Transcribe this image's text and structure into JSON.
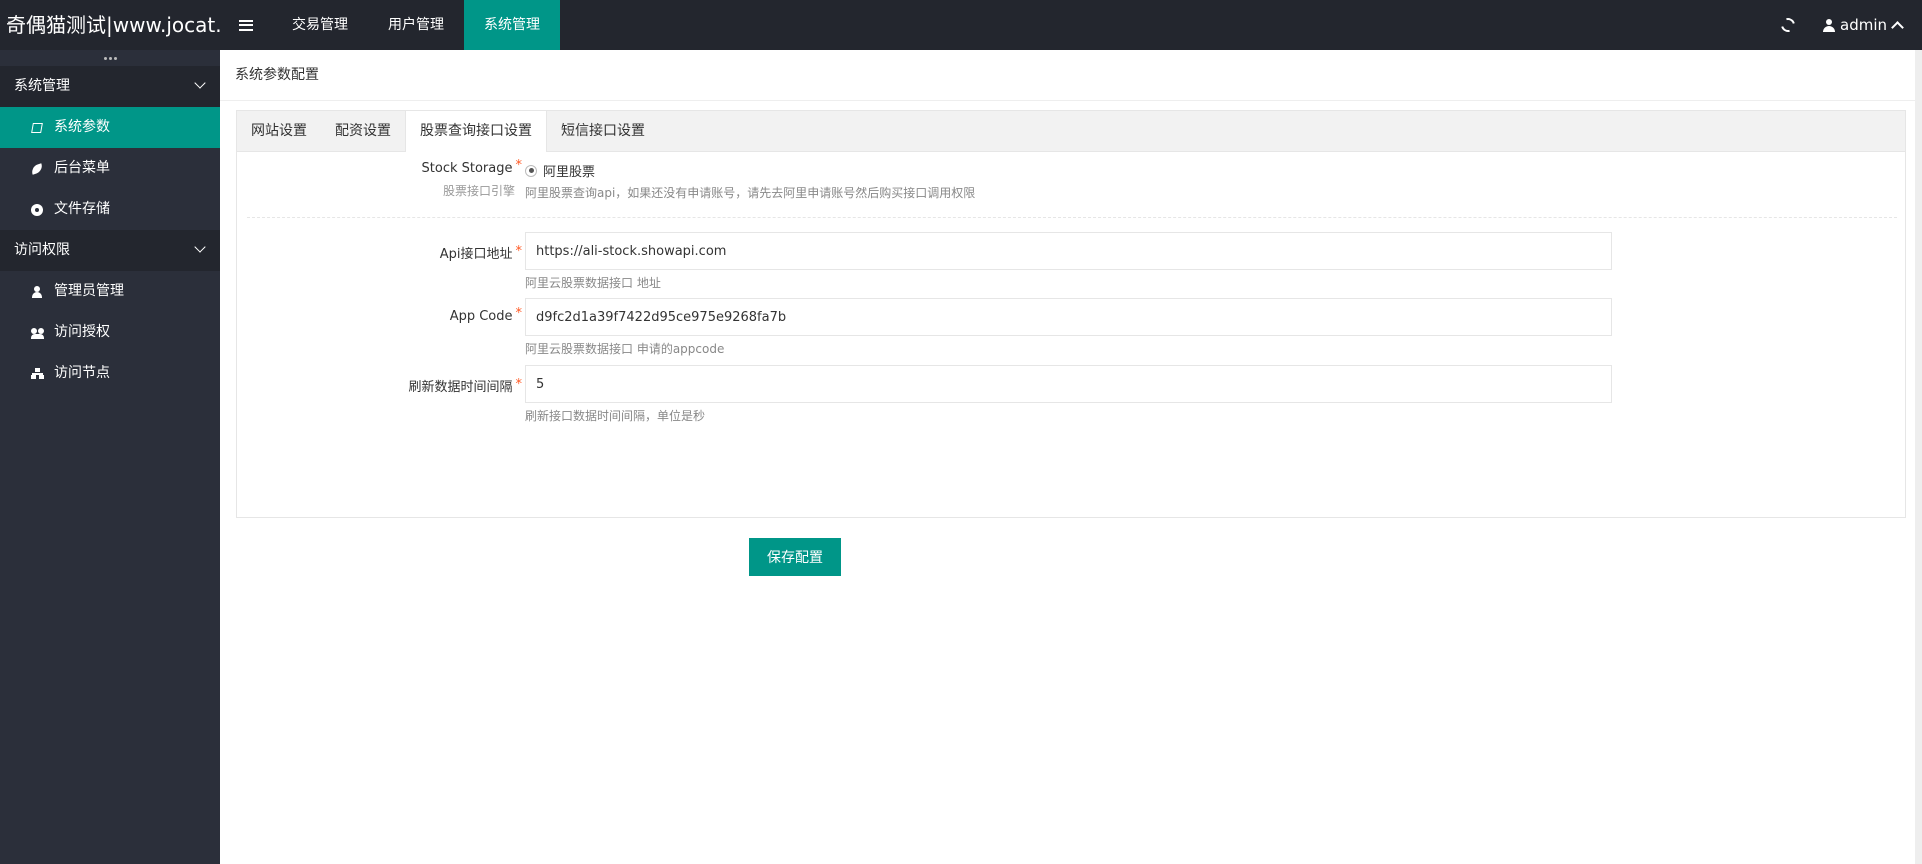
{
  "header": {
    "logo": "奇偶猫测试|www.jocat.cn",
    "nav": [
      {
        "label": "交易管理",
        "active": false
      },
      {
        "label": "用户管理",
        "active": false
      },
      {
        "label": "系统管理",
        "active": true
      }
    ],
    "user": "admin"
  },
  "sidebar": {
    "groups": [
      {
        "title": "系统管理",
        "items": [
          {
            "label": "系统参数",
            "icon": "ban-icon",
            "active": true
          },
          {
            "label": "后台菜单",
            "icon": "leaf-icon",
            "active": false
          },
          {
            "label": "文件存储",
            "icon": "dot-circle-icon",
            "active": false
          }
        ]
      },
      {
        "title": "访问权限",
        "items": [
          {
            "label": "管理员管理",
            "icon": "user-icon",
            "active": false
          },
          {
            "label": "访问授权",
            "icon": "users-icon",
            "active": false
          },
          {
            "label": "访问节点",
            "icon": "sitemap-icon",
            "active": false
          }
        ]
      }
    ]
  },
  "breadcrumb": "系统参数配置",
  "tabs": [
    "网站设置",
    "配资设置",
    "股票查询接口设置",
    "短信接口设置"
  ],
  "active_tab": 2,
  "form": {
    "storage": {
      "label": "Stock Storage",
      "sublabel": "股票接口引擎",
      "option": "阿里股票",
      "help": "阿里股票查询api，如果还没有申请账号，请先去阿里申请账号然后购买接口调用权限"
    },
    "api_url": {
      "label": "Api接口地址",
      "value": "https://ali-stock.showapi.com",
      "help": "阿里云股票数据接口 地址"
    },
    "app_code": {
      "label": "App Code",
      "value": "d9fc2d1a39f7422d95ce975e9268fa7b",
      "help": "阿里云股票数据接口 申请的appcode"
    },
    "refresh": {
      "label": "刷新数据时间间隔",
      "value": "5",
      "help": "刷新接口数据时间间隔，单位是秒"
    },
    "required_mark": "*",
    "save_label": "保存配置"
  },
  "colors": {
    "accent": "#009688",
    "header_bg": "#23262e",
    "sidebar_bg": "#2b2f3a",
    "required": "#ff5722"
  }
}
